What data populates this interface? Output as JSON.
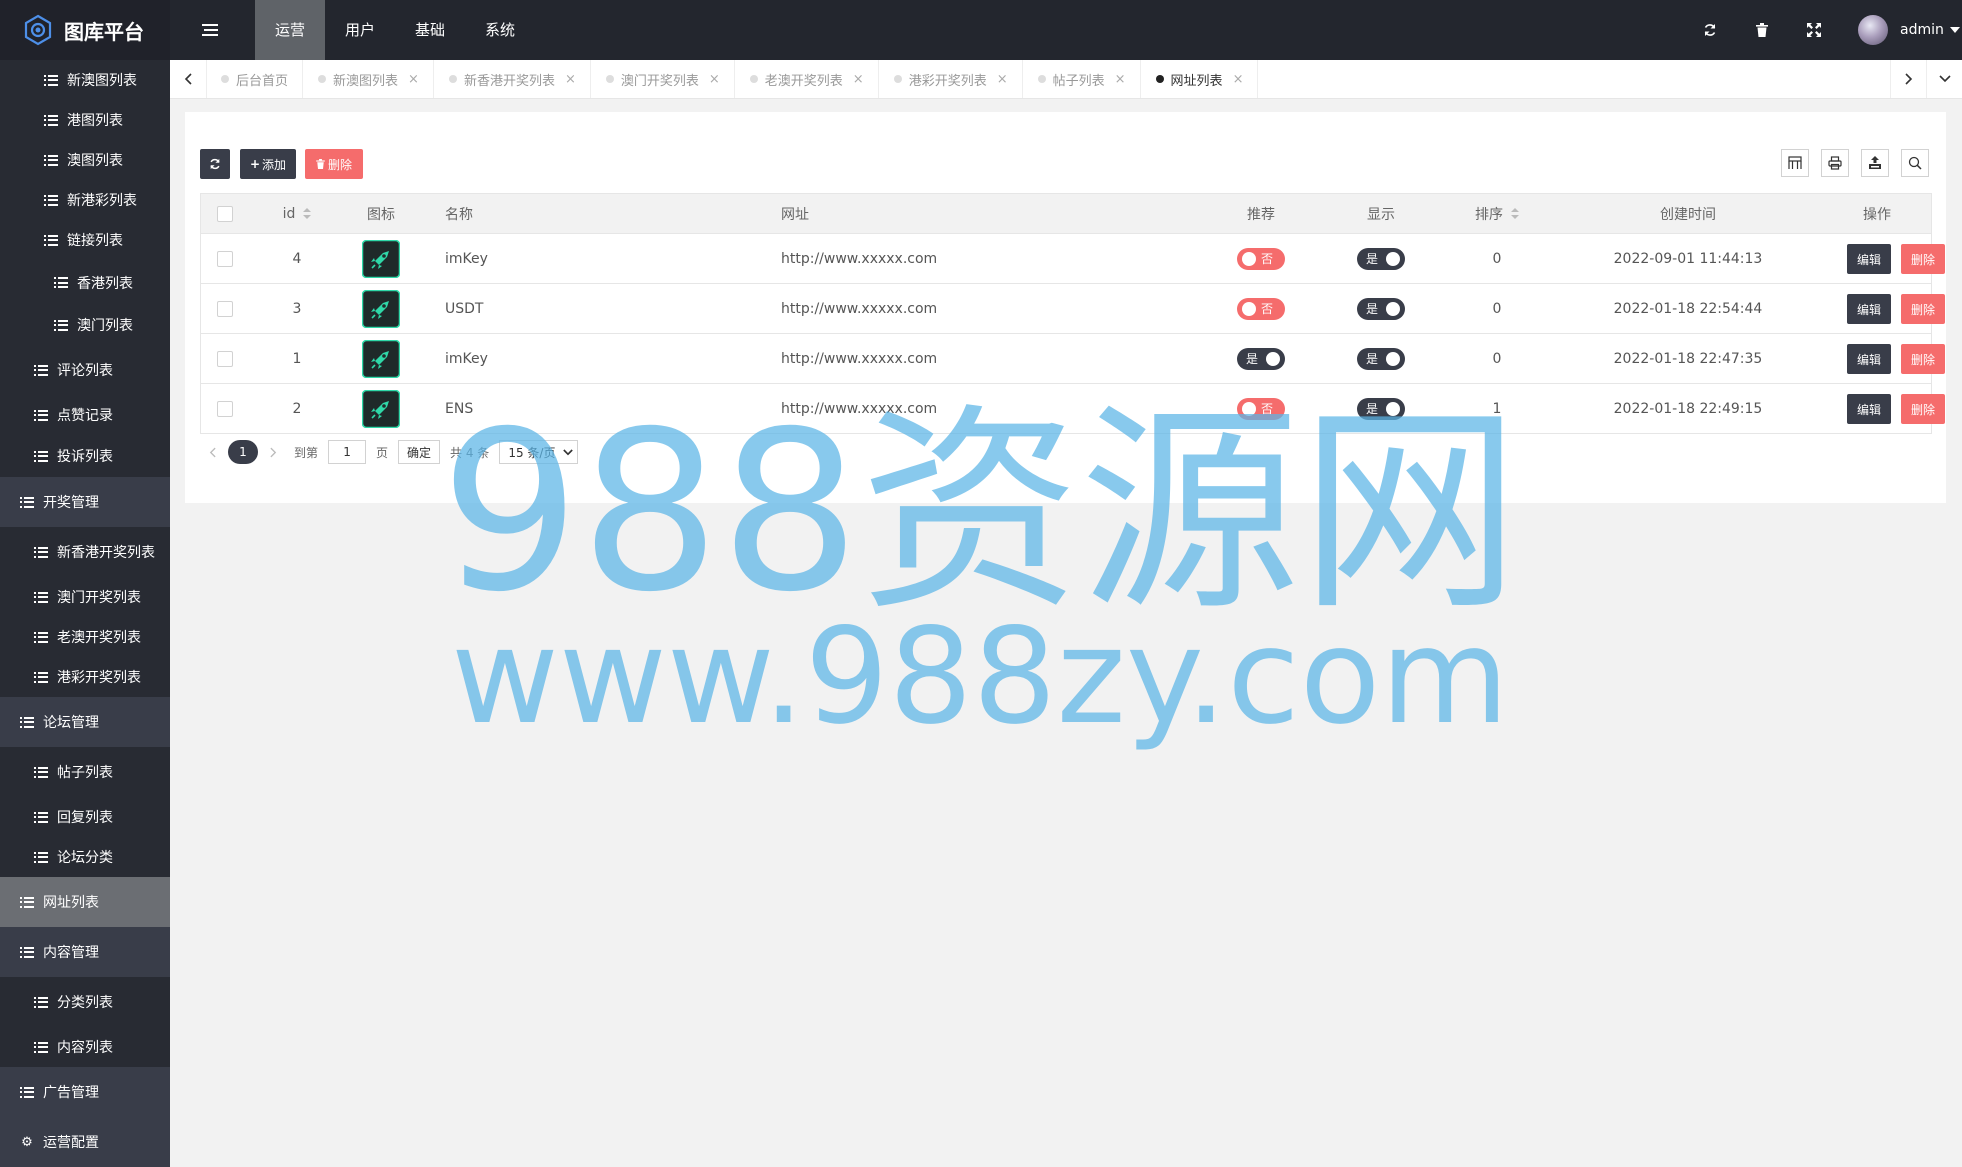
{
  "app": {
    "title": "图库平台"
  },
  "topnav": {
    "items": [
      "运营",
      "用户",
      "基础",
      "系统"
    ],
    "active_index": 0
  },
  "user": {
    "name": "admin"
  },
  "sidebar": {
    "items": [
      {
        "label": "新澳图列表",
        "level": "sub"
      },
      {
        "label": "港图列表",
        "level": "sub"
      },
      {
        "label": "澳图列表",
        "level": "sub"
      },
      {
        "label": "新港彩列表",
        "level": "sub"
      },
      {
        "label": "链接列表",
        "level": "sub"
      },
      {
        "label": "香港列表",
        "level": "subsub"
      },
      {
        "label": "澳门列表",
        "level": "subsub"
      },
      {
        "label": "评论列表",
        "level": "sub"
      },
      {
        "label": "点赞记录",
        "level": "sub"
      },
      {
        "label": "投诉列表",
        "level": "sub"
      },
      {
        "label": "开奖管理",
        "level": "top"
      },
      {
        "label": "新香港开奖列表",
        "level": "sub"
      },
      {
        "label": "澳门开奖列表",
        "level": "sub"
      },
      {
        "label": "老澳开奖列表",
        "level": "sub"
      },
      {
        "label": "港彩开奖列表",
        "level": "sub"
      },
      {
        "label": "论坛管理",
        "level": "top"
      },
      {
        "label": "帖子列表",
        "level": "sub"
      },
      {
        "label": "回复列表",
        "level": "sub"
      },
      {
        "label": "论坛分类",
        "level": "sub"
      },
      {
        "label": "网址列表",
        "level": "top",
        "active": true
      },
      {
        "label": "内容管理",
        "level": "top"
      },
      {
        "label": "分类列表",
        "level": "sub"
      },
      {
        "label": "内容列表",
        "level": "sub"
      },
      {
        "label": "广告管理",
        "level": "top"
      },
      {
        "label": "运营配置",
        "level": "top",
        "icon": "gear-icon"
      }
    ]
  },
  "tabs": [
    {
      "label": "后台首页",
      "closable": false
    },
    {
      "label": "新澳图列表",
      "closable": true
    },
    {
      "label": "新香港开奖列表",
      "closable": true
    },
    {
      "label": "澳门开奖列表",
      "closable": true
    },
    {
      "label": "老澳开奖列表",
      "closable": true
    },
    {
      "label": "港彩开奖列表",
      "closable": true
    },
    {
      "label": "帖子列表",
      "closable": true
    },
    {
      "label": "网址列表",
      "closable": true,
      "active": true
    }
  ],
  "toolbar": {
    "add_label": "添加",
    "delete_label": "删除"
  },
  "table": {
    "headers": {
      "id": "id",
      "icon": "图标",
      "name": "名称",
      "url": "网址",
      "recommend": "推荐",
      "display": "显示",
      "sort": "排序",
      "created": "创建时间",
      "ops": "操作"
    },
    "rows": [
      {
        "id": "4",
        "name": "imKey",
        "url": "http://www.xxxxx.com",
        "recommend": "否",
        "recommend_on": false,
        "display": "是",
        "display_on": true,
        "sort": "0",
        "created": "2022-09-01 11:44:13"
      },
      {
        "id": "3",
        "name": "USDT",
        "url": "http://www.xxxxx.com",
        "recommend": "否",
        "recommend_on": false,
        "display": "是",
        "display_on": true,
        "sort": "0",
        "created": "2022-01-18 22:54:44"
      },
      {
        "id": "1",
        "name": "imKey",
        "url": "http://www.xxxxx.com",
        "recommend": "是",
        "recommend_on": true,
        "display": "是",
        "display_on": true,
        "sort": "0",
        "created": "2022-01-18 22:47:35"
      },
      {
        "id": "2",
        "name": "ENS",
        "url": "http://www.xxxxx.com",
        "recommend": "否",
        "recommend_on": false,
        "display": "是",
        "display_on": true,
        "sort": "1",
        "created": "2022-01-18 22:49:15"
      }
    ],
    "edit_label": "编辑",
    "delete_label": "删除"
  },
  "pager": {
    "current": "1",
    "goto_label": "到第",
    "goto_value": "1",
    "page_unit": "页",
    "confirm_label": "确定",
    "total_label": "共 4 条",
    "page_size": "15 条/页"
  },
  "watermark": {
    "line1": "988资源网",
    "line2": "www.988zy.com",
    "color": "#5ab4e6"
  },
  "colors": {
    "topbar": "#23262e",
    "sidebar": "#393d49",
    "accent_dark": "#393d49",
    "danger": "#f56c6c",
    "icon_green": "#2fd8a8"
  }
}
